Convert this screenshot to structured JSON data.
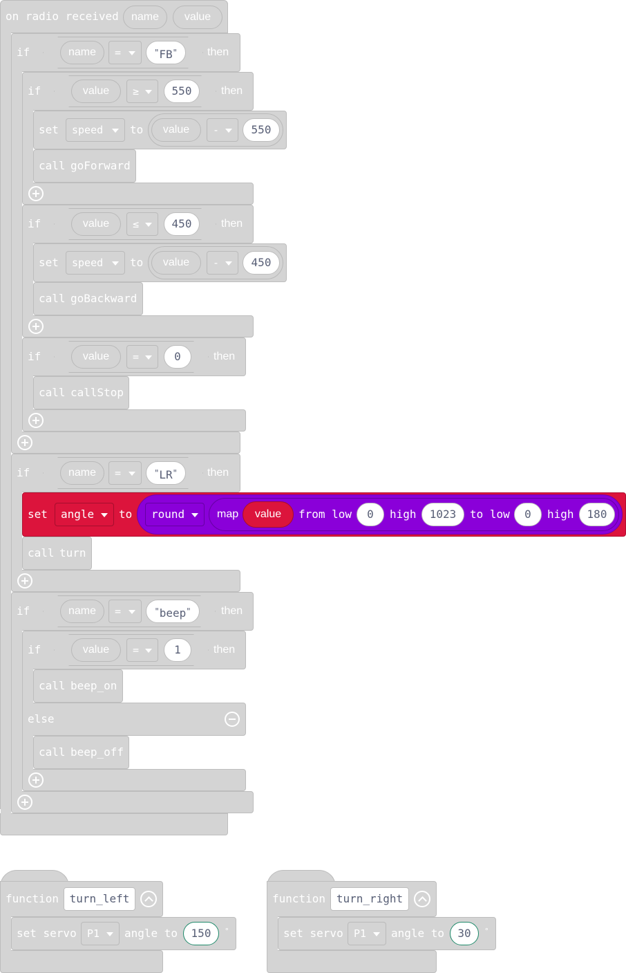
{
  "event": {
    "label": "on radio received",
    "param_name": "name",
    "param_value": "value"
  },
  "keywords": {
    "if": "if",
    "then": "then",
    "else": "else",
    "set": "set",
    "to": "to",
    "call": "call",
    "function": "function",
    "from_low": "from low",
    "high": "high",
    "to_low": "to low",
    "map": "map",
    "set_servo": "set servo",
    "angle_to": "angle to",
    "degree": "°"
  },
  "vars": {
    "name": "name",
    "value": "value",
    "speed": "speed",
    "angle": "angle"
  },
  "ops": {
    "eq": "=",
    "gte": "≥",
    "lte": "≤",
    "minus": "-",
    "round": "round"
  },
  "fb_if": {
    "str": "FB",
    "cond1_num": "550",
    "sub1_num": "550",
    "call1": "goForward",
    "cond2_num": "450",
    "sub2_num": "450",
    "call2": "goBackward",
    "cond3_num": "0",
    "call3": "callStop"
  },
  "lr_if": {
    "str": "LR",
    "from_low": "0",
    "high1": "1023",
    "to_low": "0",
    "high2": "180",
    "call": "turn"
  },
  "beep_if": {
    "str": "beep",
    "cond_num": "1",
    "call_then": "beep_on",
    "call_else": "beep_off"
  },
  "func_left": {
    "name": "turn_left",
    "pin": "P1",
    "angle": "150"
  },
  "func_right": {
    "name": "turn_right",
    "pin": "P1",
    "angle": "30"
  },
  "colors": {
    "block_gray": "#d4d4d4",
    "set_red": "#dc143c",
    "math_purple": "#8a00d9",
    "field_text": "#575e75"
  }
}
